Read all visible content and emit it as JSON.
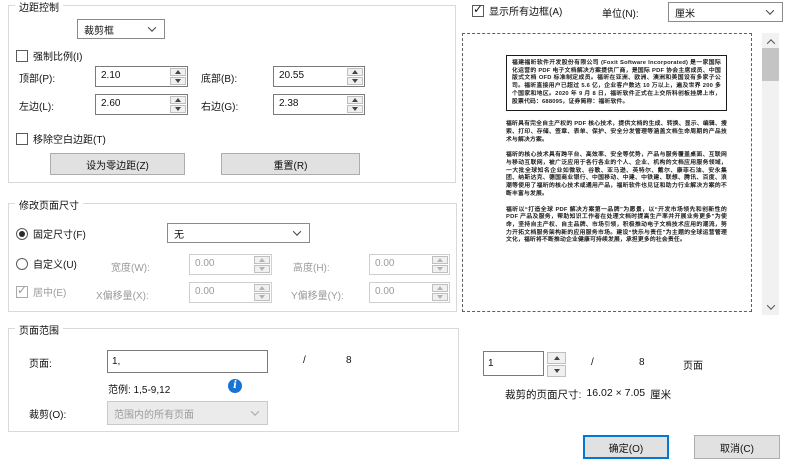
{
  "icons": {
    "checkmark": "✓",
    "info": "i"
  },
  "colors": {
    "accent": "#0078d7",
    "info_blue": "#1574d4"
  },
  "margin_control": {
    "title": "边距控制",
    "box_type": "裁剪框",
    "constrain_label": "强制比例(I)",
    "top_label": "顶部(P):",
    "top_value": "2.10",
    "bottom_label": "底部(B):",
    "bottom_value": "20.55",
    "left_label": "左边(L):",
    "left_value": "2.60",
    "right_label": "右边(G):",
    "right_value": "2.38",
    "remove_blank_label": "移除空白边距(T)",
    "zero_margin_button": "设为零边距(Z)",
    "reset_button": "重置(R)"
  },
  "page_size": {
    "title": "修改页面尺寸",
    "fixed_label": "固定尺寸(F)",
    "fixed_value": "无",
    "custom_label": "自定义(U)",
    "width_label": "宽度(W):",
    "width_value": "0.00",
    "height_label": "高度(H):",
    "height_value": "0.00",
    "center_label": "居中(E)",
    "x_offset_label": "X偏移量(X):",
    "x_offset_value": "0.00",
    "y_offset_label": "Y偏移量(Y):",
    "y_offset_value": "0.00"
  },
  "page_range": {
    "title": "页面范围",
    "page_label": "页面:",
    "page_value": "1,",
    "separator": "/",
    "total_pages": "8",
    "example_label": "范例: 1,5-9,12",
    "crop_label": "裁剪(O):",
    "crop_value": "范围内的所有页面"
  },
  "preview": {
    "show_boxes_label": "显示所有边框(A)",
    "unit_label": "单位(N):",
    "unit_value": "厘米",
    "doc": [
      "福建福昕软件开发股份有限公司 (Foxit Software Incorporated) 是一家国际化运营的 PDF 电子文档解决方案提供厂商，是国际 PDF 协会主席成员、中国版式文档 OFD 标准制定成员。福昕在亚洲、欧洲、澳洲和美国设有多家子公司。福昕直接用户已超过 5.6 亿，企业客户数达 10 万以上，遍及世界 200 多个国家和地区。2020 年 9 月 8 日，福昕软件正式在上交所科创板挂牌上市，股票代码：688095，证券简称：福昕软件。",
      "福昕具有完全自主产权的 PDF 核心技术，提供文档的生成、转换、显示、编辑、搜索、打印、存储、签章、表单、保护、安全分发管理等涵盖文档生命周期的产品技术与解决方案。",
      "福昕的核心技术具有跨平台、高效率、安全等优势，产品与服务覆盖桌面、互联网与移动互联网，被广泛应用于各行各业的个人、企业、机构的文档应用服务领域，一大批全球知名企业如微软、谷歌、亚马逊、英特尔、戴尔、康菲石油、安永集团、纳斯达克、德国商业银行、中国移动、中建、中铁建、联想、腾讯、百度、浪潮等使用了福昕的核心技术或通用产品，福昕软件也见证和助力行业解决方案的不断丰富与发展。",
      "福昕以“打造全球 PDF 解决方案第一品牌”为愿景，以“开发市场领先和创新性的 PDF 产品及服务，帮助知识工作者在处理文档时提高生产率并开展业务更多”为使命，坚持自主产权、自主品牌、市场引领，积极推动电子文档技术应用的潮流，努力开拓文档服务架构新的应用服务市场。建设“快乐与责任”为主题的全球运营管理文化，福昕将不断推动企业健康可持续发展，承担更多的社会责任。"
    ],
    "nav": {
      "page_value": "1",
      "separator": "/",
      "total_pages": "8",
      "pages_label": "页面"
    },
    "cropped_size_label": "裁剪的页面尺寸:",
    "cropped_size_value": "16.02 × 7.05",
    "cropped_size_unit": "厘米"
  },
  "footer": {
    "ok_button": "确定(O)",
    "cancel_button": "取消(C)"
  }
}
